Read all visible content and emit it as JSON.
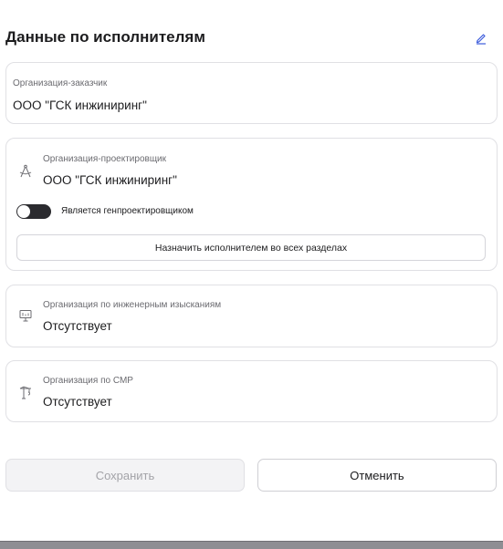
{
  "header": {
    "title": "Данные по исполнителям",
    "edit_icon": "pencil-icon",
    "accent_color": "#3b5bdb"
  },
  "customer": {
    "label": "Организация-заказчик",
    "value": "ООО \"ГСК инжиниринг\""
  },
  "designer": {
    "icon": "drafting-compass-icon",
    "label": "Организация-проектировщик",
    "value": "ООО \"ГСК инжиниринг\"",
    "toggle_label": "Является генпроектировщиком",
    "toggle_on": false,
    "assign_button": "Назначить исполнителем во всех разделах"
  },
  "surveys": {
    "icon": "presentation-board-icon",
    "label": "Организация по инженерным изысканиям",
    "value": "Отсутствует"
  },
  "construction": {
    "icon": "crane-icon",
    "label": "Организация по СМР",
    "value": "Отсутствует"
  },
  "actions": {
    "save_label": "Сохранить",
    "cancel_label": "Отменить"
  }
}
